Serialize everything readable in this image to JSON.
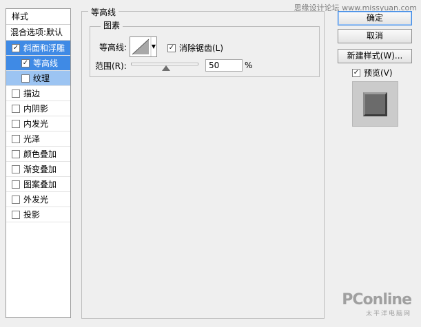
{
  "watermark": "思缘设计论坛 www.missyuan.com",
  "sidebar": {
    "header": "样式",
    "blend_options": "混合选项:默认",
    "items": [
      {
        "label": "斜面和浮雕",
        "checked": true
      },
      {
        "label": "等高线",
        "checked": true
      },
      {
        "label": "纹理",
        "checked": false
      },
      {
        "label": "描边",
        "checked": false
      },
      {
        "label": "内阴影",
        "checked": false
      },
      {
        "label": "内发光",
        "checked": false
      },
      {
        "label": "光泽",
        "checked": false
      },
      {
        "label": "颜色叠加",
        "checked": false
      },
      {
        "label": "渐变叠加",
        "checked": false
      },
      {
        "label": "图案叠加",
        "checked": false
      },
      {
        "label": "外发光",
        "checked": false
      },
      {
        "label": "投影",
        "checked": false
      }
    ]
  },
  "main": {
    "section_title": "等高线",
    "subsection_title": "图素",
    "contour_label": "等高线:",
    "antialias_label": "消除锯齿(L)",
    "antialias_checked": true,
    "range_label": "范围(R):",
    "range_value": "50",
    "range_unit": "%"
  },
  "buttons": {
    "ok": "确定",
    "cancel": "取消",
    "new_style": "新建样式(W)...",
    "preview_label": "预览(V)",
    "preview_checked": true
  },
  "logo": {
    "main": "PConline",
    "sub": "太平洋电脑网"
  },
  "colors": {
    "selection": "#3f8ae5",
    "sub_selection": "#9cc4f2",
    "panel_bg": "#efefef"
  }
}
